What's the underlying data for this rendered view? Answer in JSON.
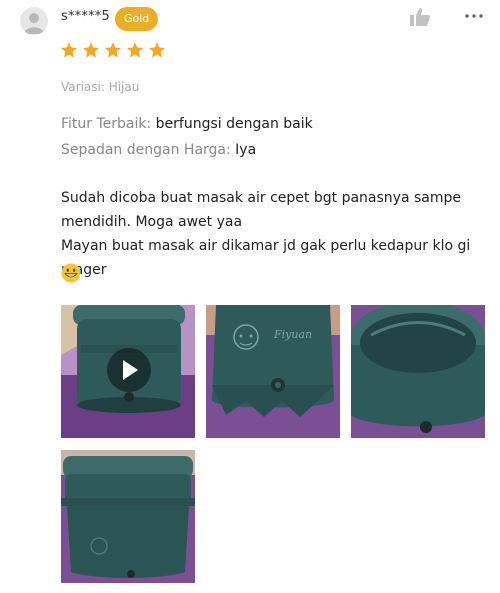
{
  "review": {
    "username": "s*****5",
    "badge": "Gold",
    "rating": 5,
    "variation": "Variasi: Hijau",
    "attributes": [
      {
        "label": "Fitur Terbaik:",
        "value": " berfungsi dengan baik"
      },
      {
        "label": "Sepadan dengan Harga:",
        "value": " Iya"
      }
    ],
    "text": "Sudah dicoba buat masak air cepet bgt panasnya sampe mendidih. Moga awet yaa\nMayan buat masak air dikamar jd gak perlu kedapur klo gi mager",
    "emoji": "grinning-face-emoji",
    "media": [
      {
        "type": "video",
        "icon": "play-icon"
      },
      {
        "type": "image"
      },
      {
        "type": "image"
      },
      {
        "type": "image"
      }
    ],
    "product_logo": "Fiyuan"
  },
  "icons": {
    "like": "thumbs-up-icon",
    "more": "more-dots-icon"
  },
  "colors": {
    "star": "#f5a623",
    "badge": "#e9ad2a",
    "pot": "#2f5a5a",
    "surface": "#6b3e86"
  }
}
